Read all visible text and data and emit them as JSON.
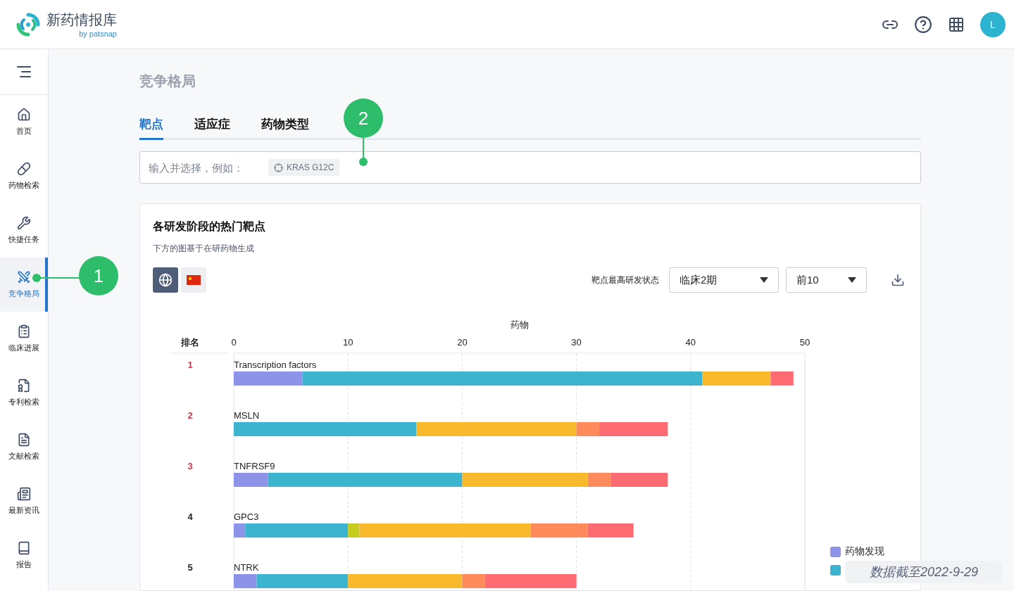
{
  "header": {
    "logo_title": "新药情报库",
    "logo_subtitle": "by patsnap",
    "avatar": "L"
  },
  "sidebar": {
    "items": [
      {
        "label": "首页",
        "selected": false
      },
      {
        "label": "药物检索",
        "selected": false
      },
      {
        "label": "快捷任务",
        "selected": false
      },
      {
        "label": "竞争格局",
        "selected": true
      },
      {
        "label": "临床进展",
        "selected": false
      },
      {
        "label": "专利检索",
        "selected": false
      },
      {
        "label": "文献检索",
        "selected": false
      },
      {
        "label": "最新资讯",
        "selected": false
      },
      {
        "label": "报告",
        "selected": false
      }
    ]
  },
  "page_title": "竞争格局",
  "tabs": [
    {
      "label": "靶点",
      "selected": true
    },
    {
      "label": "适应症",
      "selected": false
    },
    {
      "label": "药物类型",
      "selected": false
    }
  ],
  "search": {
    "placeholder": "输入并选择，例如：",
    "example": "KRAS G12C"
  },
  "card": {
    "title": "各研发阶段的热门靶点",
    "subtitle": "下方的图基于在研药物生成",
    "scope_buttons": [
      {
        "kind": "global",
        "selected": true
      },
      {
        "kind": "china",
        "selected": false
      }
    ],
    "filter_label": "靶点最高研发状态",
    "phase_select": "临床2期",
    "top_select": "前10",
    "rank_header": "排名",
    "ranks": [
      "1",
      "2",
      "3",
      "4",
      "5"
    ],
    "chart_data": {
      "type": "bar",
      "orientation": "horizontal",
      "stacked": true,
      "grid": true,
      "legend": "right",
      "xlabel": "药物",
      "xlim": [
        0,
        50
      ],
      "xticks": [
        0,
        10,
        20,
        30,
        40,
        50
      ],
      "categories": [
        "Transcription factors",
        "MSLN",
        "TNFRSF9",
        "GPC3",
        "NTRK"
      ],
      "series": [
        {
          "name": "药物发现",
          "color": "#8c93e8",
          "values": [
            6,
            0,
            3,
            1,
            2
          ]
        },
        {
          "color": "#3cb4d0",
          "values": [
            35,
            16,
            17,
            9,
            8
          ]
        },
        {
          "color": "#c5cc1e",
          "values": [
            0,
            0,
            0,
            1,
            0
          ]
        },
        {
          "color": "#f8ba2c",
          "values": [
            6,
            14,
            11,
            15,
            10
          ]
        },
        {
          "color": "#ff8a5c",
          "values": [
            0,
            2,
            2,
            5,
            2
          ]
        },
        {
          "color": "#ff6b72",
          "values": [
            2,
            6,
            5,
            4,
            8
          ]
        }
      ]
    }
  },
  "data_date": "数据截至2022-9-29",
  "callouts": [
    {
      "label": "1"
    },
    {
      "label": "2"
    }
  ]
}
